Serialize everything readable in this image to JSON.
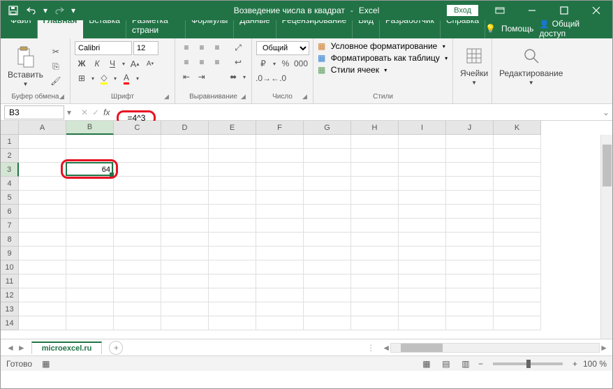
{
  "title": {
    "doc": "Возведение числа в квадрат",
    "app": "Excel"
  },
  "signin": "Вход",
  "tabs": [
    "Файл",
    "Главная",
    "Вставка",
    "Разметка страни",
    "Формулы",
    "Данные",
    "Рецензирование",
    "Вид",
    "Разработчик",
    "Справка"
  ],
  "active_tab": 1,
  "help": "Помощь",
  "share": "Общий доступ",
  "groups": {
    "clipboard": {
      "label": "Буфер обмена",
      "paste": "Вставить"
    },
    "font": {
      "label": "Шрифт",
      "name": "Calibri",
      "size": "12"
    },
    "align": {
      "label": "Выравнивание"
    },
    "number": {
      "label": "Число",
      "format": "Общий"
    },
    "styles": {
      "label": "Стили",
      "cond": "Условное форматирование",
      "table": "Форматировать как таблицу",
      "cell": "Стили ячеек"
    },
    "cells": {
      "label": "Ячейки"
    },
    "editing": {
      "label": "Редактирование"
    }
  },
  "name_box": "B3",
  "formula": "=4^3",
  "columns": [
    "A",
    "B",
    "C",
    "D",
    "E",
    "F",
    "G",
    "H",
    "I",
    "J",
    "K"
  ],
  "rows": 14,
  "sel": {
    "col": 1,
    "row": 2
  },
  "cell_value": "64",
  "sheet": "microexcel.ru",
  "status": "Готово",
  "zoom": "100 %"
}
